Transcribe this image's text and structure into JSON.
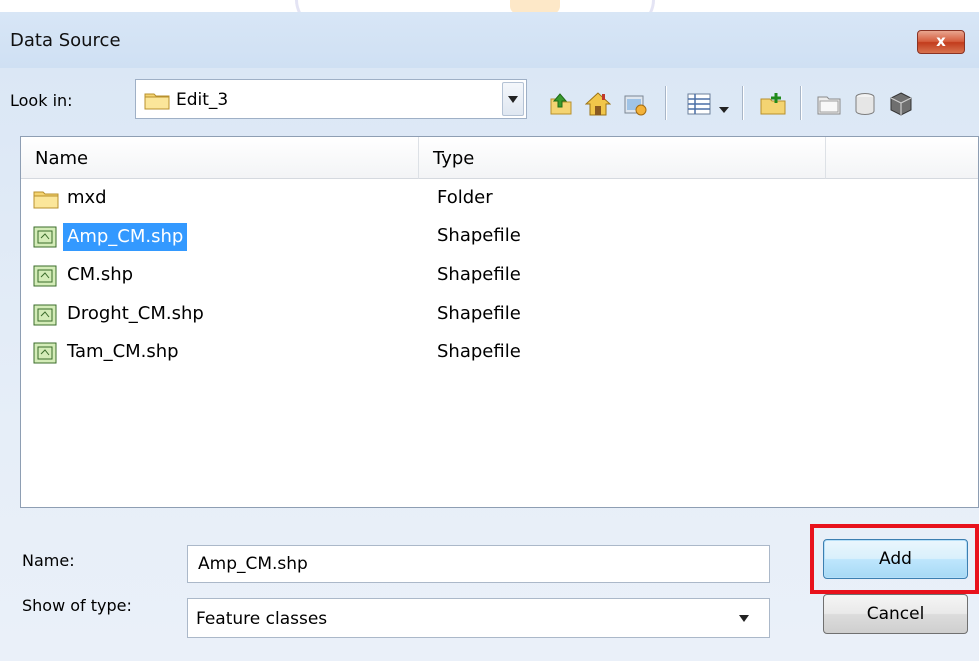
{
  "dialog": {
    "title": "Data Source",
    "close_label": "x"
  },
  "lookin": {
    "label": "Look in:",
    "value": "Edit_3"
  },
  "toolbar": {
    "icons": [
      "up-one-level-icon",
      "home-icon",
      "connect-folder-icon",
      "view-menu-icon",
      "new-folder-icon",
      "new-file-geodatabase-icon",
      "new-personal-geodatabase-icon",
      "new-database-connection-icon"
    ]
  },
  "list": {
    "columns": [
      "Name",
      "Type"
    ],
    "items": [
      {
        "name": "mxd",
        "type": "Folder",
        "icon": "folder-icon"
      },
      {
        "name": "Amp_CM.shp",
        "type": "Shapefile",
        "icon": "shapefile-icon",
        "selected": true
      },
      {
        "name": "CM.shp",
        "type": "Shapefile",
        "icon": "shapefile-icon"
      },
      {
        "name": "Droght_CM.shp",
        "type": "Shapefile",
        "icon": "shapefile-icon"
      },
      {
        "name": "Tam_CM.shp",
        "type": "Shapefile",
        "icon": "shapefile-icon"
      }
    ]
  },
  "footer": {
    "name_label": "Name:",
    "name_value": "Amp_CM.shp",
    "type_label": "Show of type:",
    "type_value": "Feature classes",
    "add_label": "Add",
    "cancel_label": "Cancel"
  },
  "colors": {
    "selection": "#3399ff",
    "highlight": "#e8121c"
  }
}
